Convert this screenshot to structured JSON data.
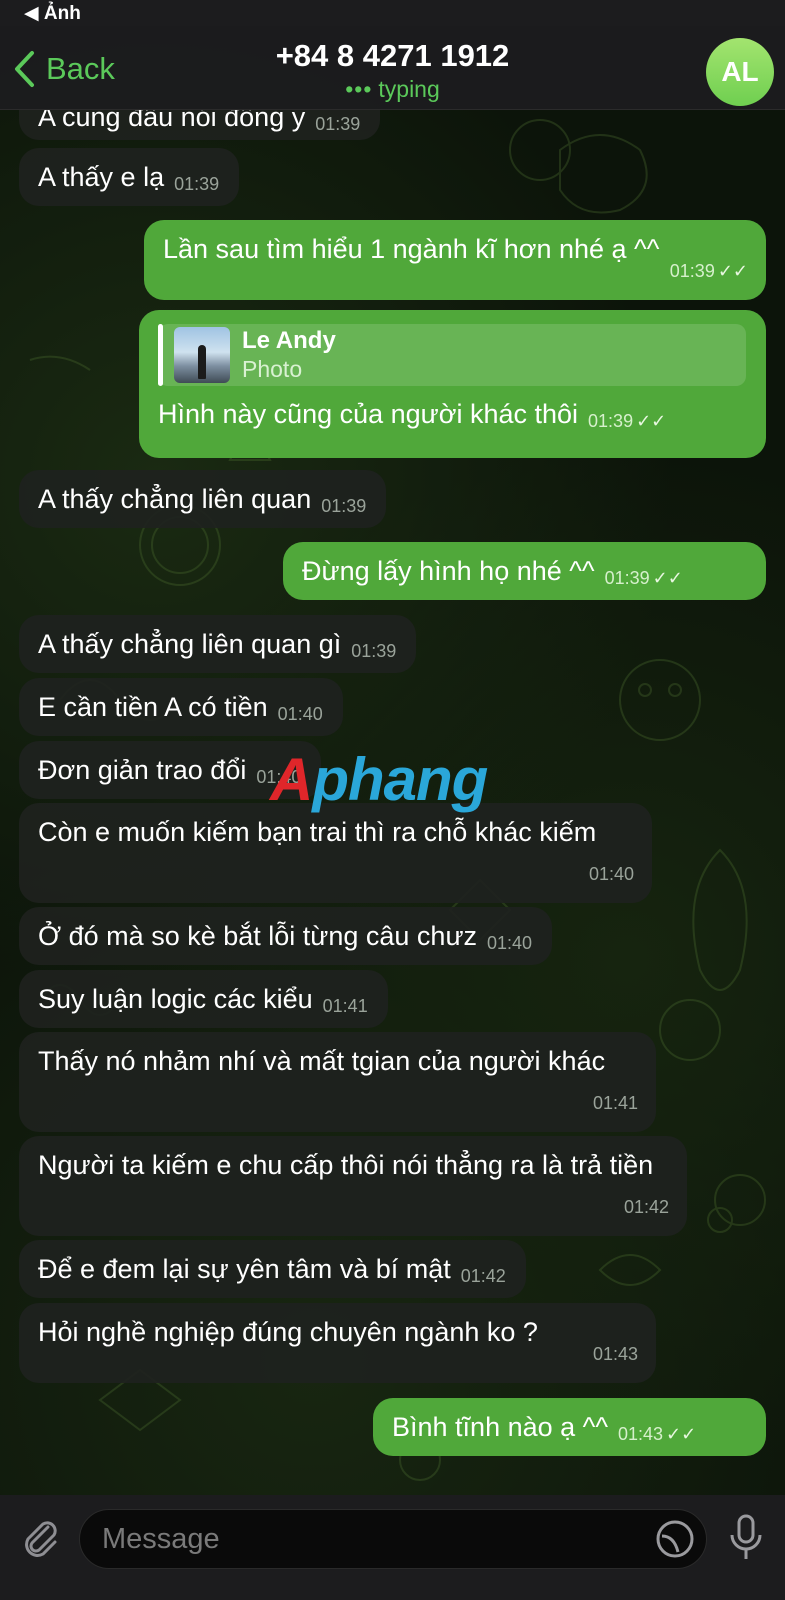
{
  "status_bar": {
    "back_label": "◀ Ảnh"
  },
  "header": {
    "back_label": "Back",
    "title": "+84 8 4271 1912",
    "subtitle": "typing",
    "avatar_initials": "AL"
  },
  "messages": [
    {
      "dir": "in",
      "text": "A cũng đâu nói đồng ý",
      "time": "01:39"
    },
    {
      "dir": "in",
      "text": "A thấy e lạ",
      "time": "01:39"
    },
    {
      "dir": "out",
      "text": "Lần sau tìm hiểu 1 ngành kĩ hơn nhé ạ ^^",
      "time": "01:39",
      "ticks": "✓✓"
    },
    {
      "dir": "out",
      "reply_name": "Le Andy",
      "reply_sub": "Photo",
      "text": "Hình này cũng của người khác thôi",
      "time": "01:39",
      "ticks": "✓✓"
    },
    {
      "dir": "in",
      "text": "A thấy chẳng liên quan",
      "time": "01:39"
    },
    {
      "dir": "out",
      "text": "Đừng lấy hình họ nhé ^^",
      "time": "01:39",
      "ticks": "✓✓"
    },
    {
      "dir": "in",
      "text": "A thấy chẳng liên quan gì",
      "time": "01:39"
    },
    {
      "dir": "in",
      "text": "E cần tiền A có tiền",
      "time": "01:40"
    },
    {
      "dir": "in",
      "text": "Đơn giản trao đổi",
      "time": "01:40"
    },
    {
      "dir": "in",
      "text": "Còn e muốn kiếm bạn trai thì ra chỗ khác kiếm",
      "time": "01:40"
    },
    {
      "dir": "in",
      "text": "Ở đó mà so kè bắt lỗi từng câu chưz",
      "time": "01:40"
    },
    {
      "dir": "in",
      "text": "Suy luận logic các kiểu",
      "time": "01:41"
    },
    {
      "dir": "in",
      "text": "Thấy nó nhảm nhí và mất tgian của người khác",
      "time": "01:41"
    },
    {
      "dir": "in",
      "text": "Người ta kiếm e chu cấp thôi nói thẳng ra là trả tiền",
      "time": "01:42"
    },
    {
      "dir": "in",
      "text": "Để e đem lại sự yên tâm và bí mật",
      "time": "01:42"
    },
    {
      "dir": "in",
      "text": "Hỏi nghề nghiệp đúng chuyên ngành ko ?",
      "time": "01:43"
    },
    {
      "dir": "out",
      "text": "Bình tĩnh nào ạ ^^",
      "time": "01:43",
      "ticks": "✓✓"
    }
  ],
  "watermark": {
    "first": "A",
    "rest": "phang"
  },
  "input": {
    "placeholder": "Message"
  },
  "colors": {
    "accent": "#5bc95a",
    "outgoing": "#50a83a",
    "incoming": "#1e221e"
  }
}
